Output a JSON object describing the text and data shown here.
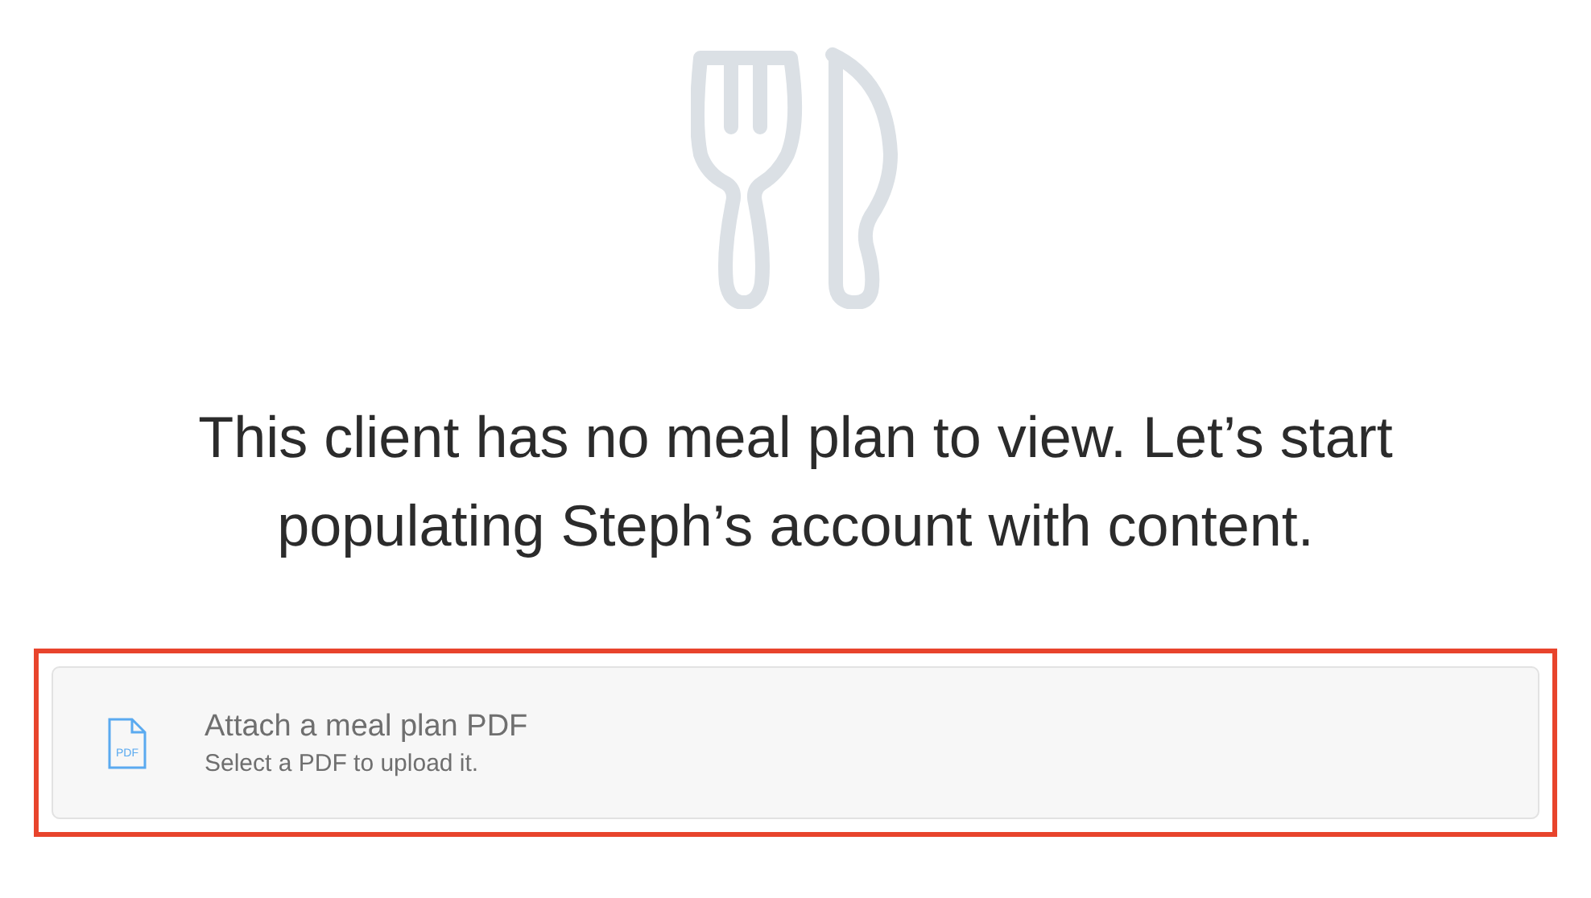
{
  "empty_state": {
    "message": "This client has no meal plan to view. Let’s start populating Steph’s account with content."
  },
  "attach_card": {
    "highlighted": true,
    "file_icon_label": "PDF",
    "title": "Attach a meal plan PDF",
    "subtitle": "Select a PDF to upload it."
  }
}
